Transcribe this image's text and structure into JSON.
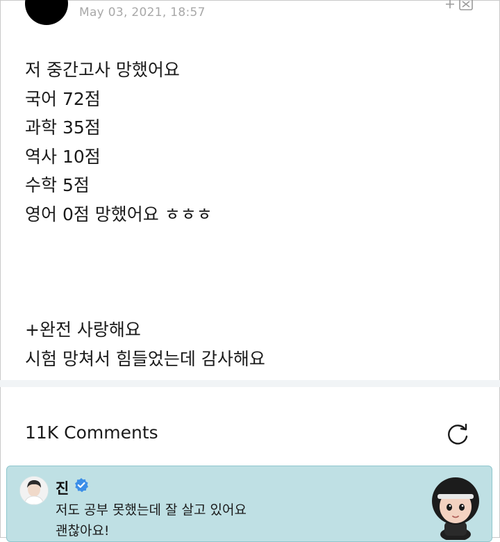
{
  "post": {
    "timestamp": "May 03, 2021, 18:57",
    "lines": [
      "저 중간고사 망했어요",
      "국어 72점",
      "과학 35점",
      "역사 10점",
      "수학 5점",
      "영어 0점 망했어요 ㅎㅎㅎ"
    ],
    "extra_lines": [
      "+완전 사랑해요",
      "시험 망쳐서 힘들었는데 감사해요"
    ]
  },
  "comments": {
    "header": "11K Comments"
  },
  "comment": {
    "author": "진",
    "lines": [
      "저도 공부 못했는데 잘 살고 있어요",
      "괜찮아요!"
    ]
  },
  "icons": {
    "translate": "translate-icon",
    "refresh": "refresh-icon",
    "verified": "verified-badge-icon"
  },
  "colors": {
    "card_bg": "#bfe0e4",
    "verified": "#3b8ee8",
    "timestamp": "#a8a8a8"
  }
}
